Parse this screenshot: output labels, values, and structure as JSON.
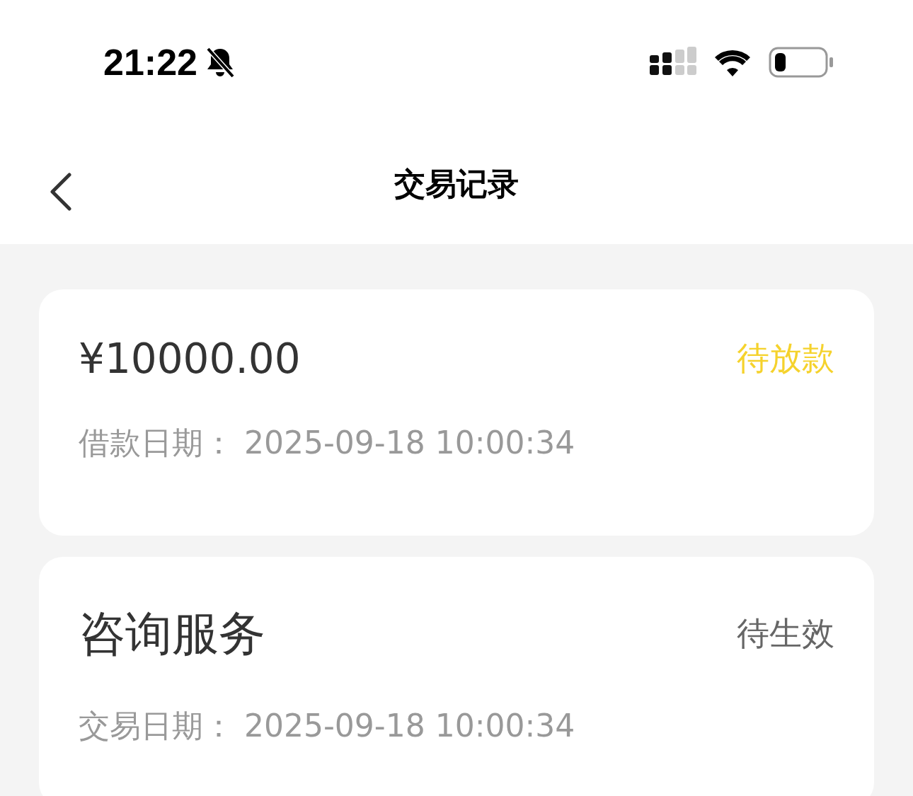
{
  "status_bar": {
    "time": "21:22"
  },
  "nav_bar": {
    "title": "交易记录"
  },
  "records": [
    {
      "title": "¥10000.00",
      "kind": "amount",
      "status": {
        "text": "待放款",
        "color": "#f5d22c"
      },
      "date_label": "借款日期：",
      "date": "2025-09-18 10:00:34"
    },
    {
      "title": "咨询服务",
      "kind": "service",
      "status": {
        "text": "待生效",
        "color": "#666666"
      },
      "date_label": "交易日期：",
      "date": "2025-09-18 10:00:34"
    }
  ]
}
